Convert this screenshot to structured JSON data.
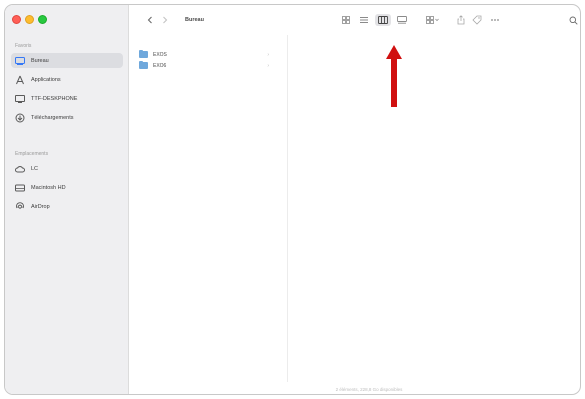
{
  "window": {
    "sidebar": {
      "sections": [
        {
          "title": "Favoris",
          "items": [
            {
              "label": "Bureau",
              "icon": "desktop-icon",
              "active": true
            },
            {
              "label": "Applications",
              "icon": "applications-icon",
              "active": false
            },
            {
              "label": "TTF-DESKPHONE",
              "icon": "display-icon",
              "active": false
            },
            {
              "label": "Téléchargements",
              "icon": "download-icon",
              "active": false
            }
          ]
        },
        {
          "title": "Emplacements",
          "items": [
            {
              "label": "LC",
              "icon": "cloud-icon",
              "active": false
            },
            {
              "label": "Macintosh HD",
              "icon": "disk-icon",
              "active": false
            },
            {
              "label": "AirDrop",
              "icon": "airdrop-icon",
              "active": false
            }
          ]
        }
      ]
    },
    "toolbar": {
      "title": "Bureau",
      "tools": [
        "icon-view-icon",
        "list-view-icon",
        "column-view-icon",
        "gallery-view-icon",
        "group-icon",
        "share-icon",
        "tag-icon",
        "more-icon",
        "search-icon"
      ],
      "selected_tool": "column-view-icon"
    },
    "files": [
      {
        "name": "EXOS"
      },
      {
        "name": "EXO6"
      }
    ],
    "status_text": "2 éléments, 228,8 Go disponibles"
  },
  "colors": {
    "accent": "#3478f6",
    "annotation_arrow": "#d01010",
    "folder": "#6fa8dc"
  }
}
